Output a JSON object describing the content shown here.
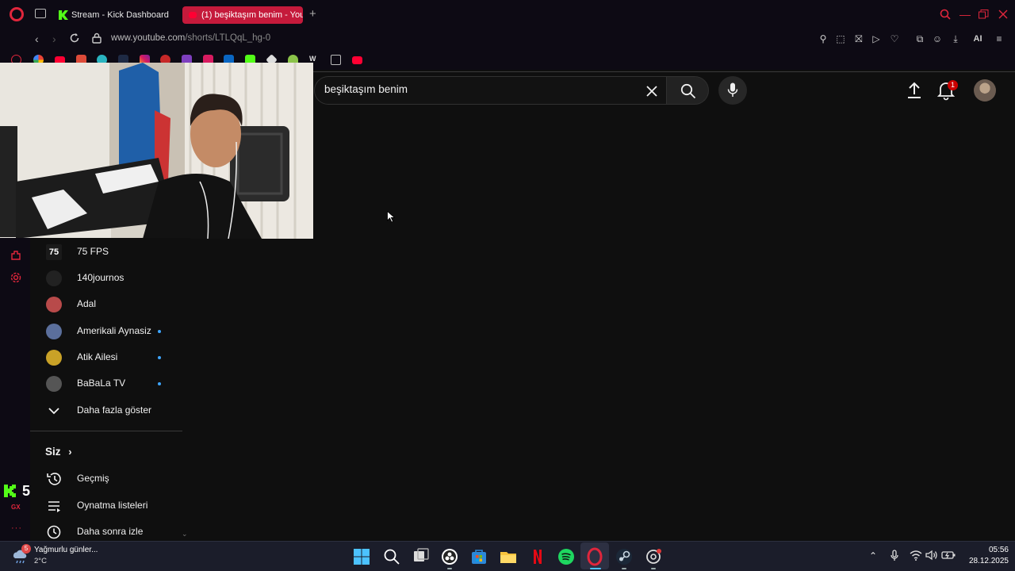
{
  "browser": {
    "tabs": [
      {
        "label": "Stream - Kick Dashboard",
        "active": false
      },
      {
        "label": "(1) beşiktaşım benim - You",
        "active": true
      }
    ],
    "url_host": "www.youtube.com",
    "url_path": "/shorts/LTLQqL_hg-0",
    "ai_label": "AI"
  },
  "youtube": {
    "search_value": "beşiktaşım benim",
    "notification_count": "1",
    "subscriptions": [
      {
        "label": "75 FPS",
        "dot": false,
        "color": "#1a1a1a"
      },
      {
        "label": "140journos",
        "dot": false,
        "color": "#222222"
      },
      {
        "label": "Adal",
        "dot": false,
        "color": "#b84a4a"
      },
      {
        "label": "Amerikali Aynasiz",
        "dot": true,
        "color": "#5b6f9c"
      },
      {
        "label": "Atik Ailesi",
        "dot": true,
        "color": "#c9a227"
      },
      {
        "label": "BaBaLa TV",
        "dot": true,
        "color": "#555555"
      }
    ],
    "show_more_label": "Daha fazla göster",
    "you_section_label": "Siz",
    "you_items": [
      {
        "label": "Geçmiş",
        "icon": "history-icon"
      },
      {
        "label": "Oynatma listeleri",
        "icon": "playlist-icon"
      },
      {
        "label": "Daha sonra izle",
        "icon": "watch-later-icon"
      }
    ]
  },
  "overlay": {
    "kick_count": "5",
    "gx_label": "GX"
  },
  "taskbar": {
    "weather_title": "Yağmurlu günler...",
    "weather_temp": "2°C",
    "weather_badge": "5",
    "time": "05:56",
    "date": "28.12.2025"
  },
  "colors": {
    "opera_red": "#e0263c",
    "active_tab": "#c51a3b",
    "kick_green": "#53fc18",
    "youtube_red": "#ff0033"
  }
}
